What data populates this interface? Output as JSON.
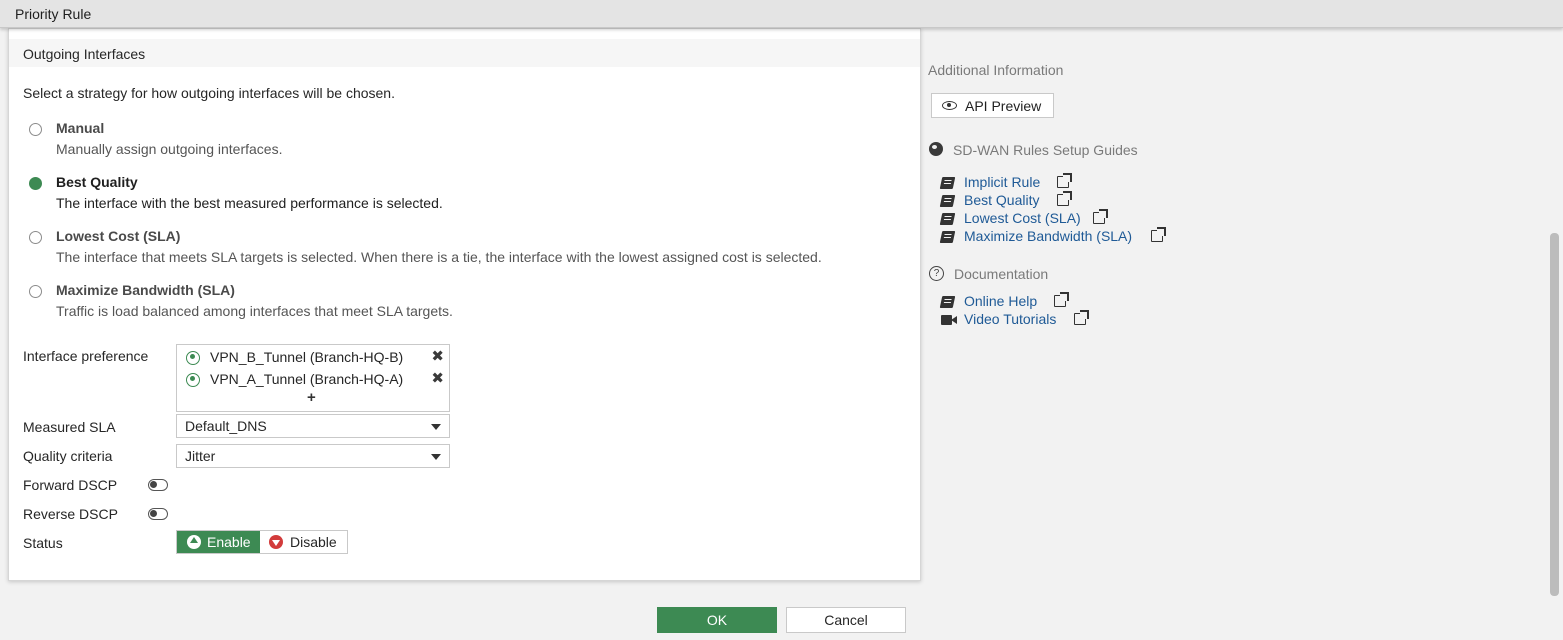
{
  "window": {
    "title": "Priority Rule"
  },
  "outgoing": {
    "section_title": "Outgoing Interfaces",
    "intro": "Select a strategy for how outgoing interfaces will be chosen.",
    "options": [
      {
        "label": "Manual",
        "desc": "Manually assign outgoing interfaces.",
        "selected": false
      },
      {
        "label": "Best Quality",
        "desc": "The interface with the best measured performance is selected.",
        "selected": true
      },
      {
        "label": "Lowest Cost (SLA)",
        "desc": "The interface that meets SLA targets is selected. When there is a tie, the interface with the lowest assigned cost is selected.",
        "selected": false
      },
      {
        "label": "Maximize Bandwidth (SLA)",
        "desc": "Traffic is load balanced among interfaces that meet SLA targets.",
        "selected": false
      }
    ]
  },
  "form": {
    "interface_pref_label": "Interface preference",
    "interfaces": [
      "VPN_B_Tunnel (Branch-HQ-B)",
      "VPN_A_Tunnel (Branch-HQ-A)"
    ],
    "add_symbol": "+",
    "remove_symbol": "✖",
    "measured_sla_label": "Measured SLA",
    "measured_sla_value": "Default_DNS",
    "quality_label": "Quality criteria",
    "quality_value": "Jitter",
    "forward_dscp_label": "Forward DSCP",
    "forward_dscp_enabled": false,
    "reverse_dscp_label": "Reverse DSCP",
    "reverse_dscp_enabled": false,
    "status_label": "Status",
    "enable_label": "Enable",
    "disable_label": "Disable"
  },
  "sidebar": {
    "additional_heading": "Additional Information",
    "api_preview_label": "API Preview",
    "guides_heading": "SD-WAN Rules Setup Guides",
    "guides": [
      "Implicit Rule",
      "Best Quality",
      "Lowest Cost (SLA)",
      "Maximize Bandwidth (SLA)"
    ],
    "doc_heading": "Documentation",
    "help_glyph": "?",
    "docs": [
      "Online Help",
      "Video Tutorials"
    ]
  },
  "footer": {
    "ok_label": "OK",
    "cancel_label": "Cancel"
  },
  "colors": {
    "accent": "#3d8a53",
    "link": "#1f5a96",
    "danger": "#d23b3b"
  }
}
